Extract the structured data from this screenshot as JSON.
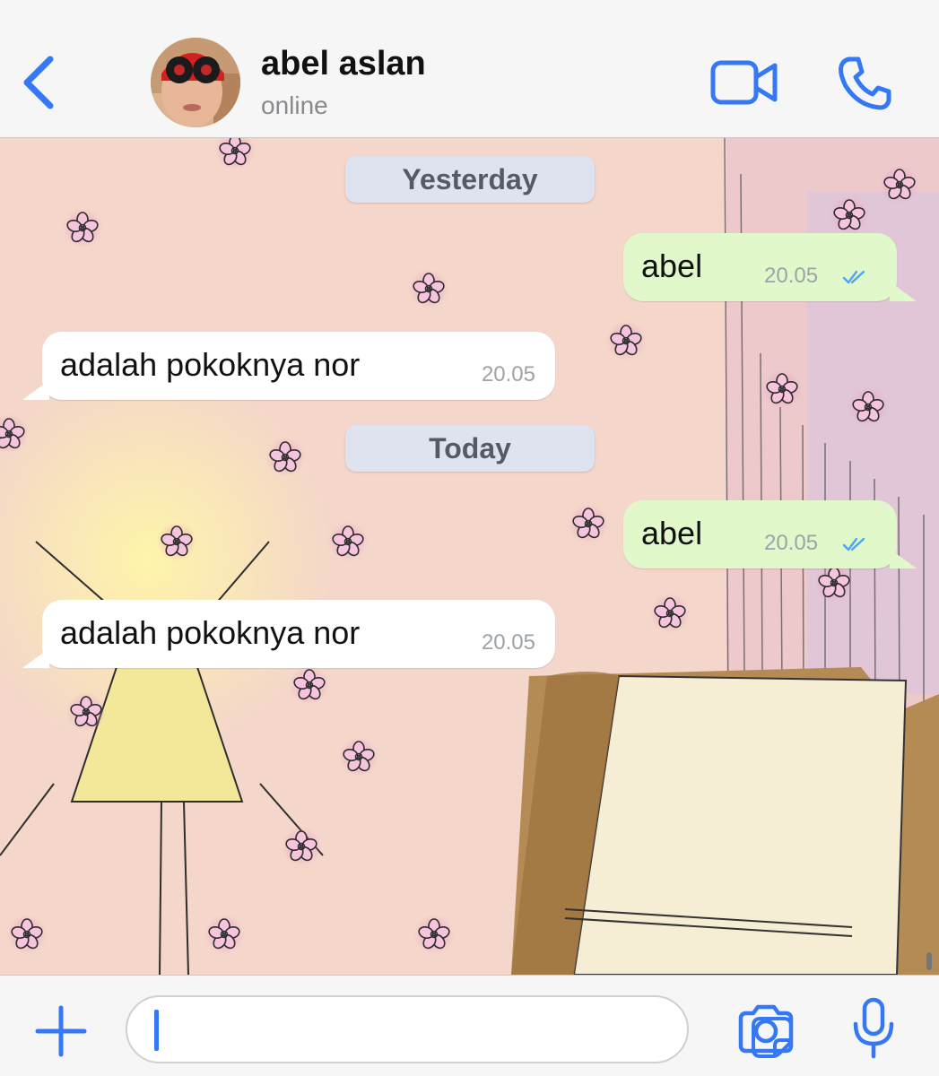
{
  "header": {
    "contact_name": "abel aslan",
    "status": "online",
    "icons": [
      "chevron-left-icon",
      "video-camera-icon",
      "phone-icon"
    ]
  },
  "chat": {
    "dates": [
      "Yesterday",
      "Today"
    ],
    "messages": [
      {
        "direction": "outgoing",
        "text": "abel",
        "time": "20.05",
        "status": "read"
      },
      {
        "direction": "incoming",
        "text": "adalah pokoknya nor",
        "time": "20.05"
      },
      {
        "direction": "outgoing",
        "text": "abel",
        "time": "20.05",
        "status": "read"
      },
      {
        "direction": "incoming",
        "text": "adalah pokoknya nor",
        "time": "20.05"
      }
    ]
  },
  "composer": {
    "value": "",
    "icons": [
      "plus-icon",
      "sticker-icon",
      "camera-icon",
      "microphone-icon"
    ]
  },
  "colors": {
    "accent": "#3478f6",
    "outgoing_bubble": "#e1f8cb",
    "incoming_bubble": "#ffffff",
    "date_pill": "#dfe3f0",
    "read_ticks": "#4fa3f7",
    "wallpaper": "#f3d6cb"
  }
}
